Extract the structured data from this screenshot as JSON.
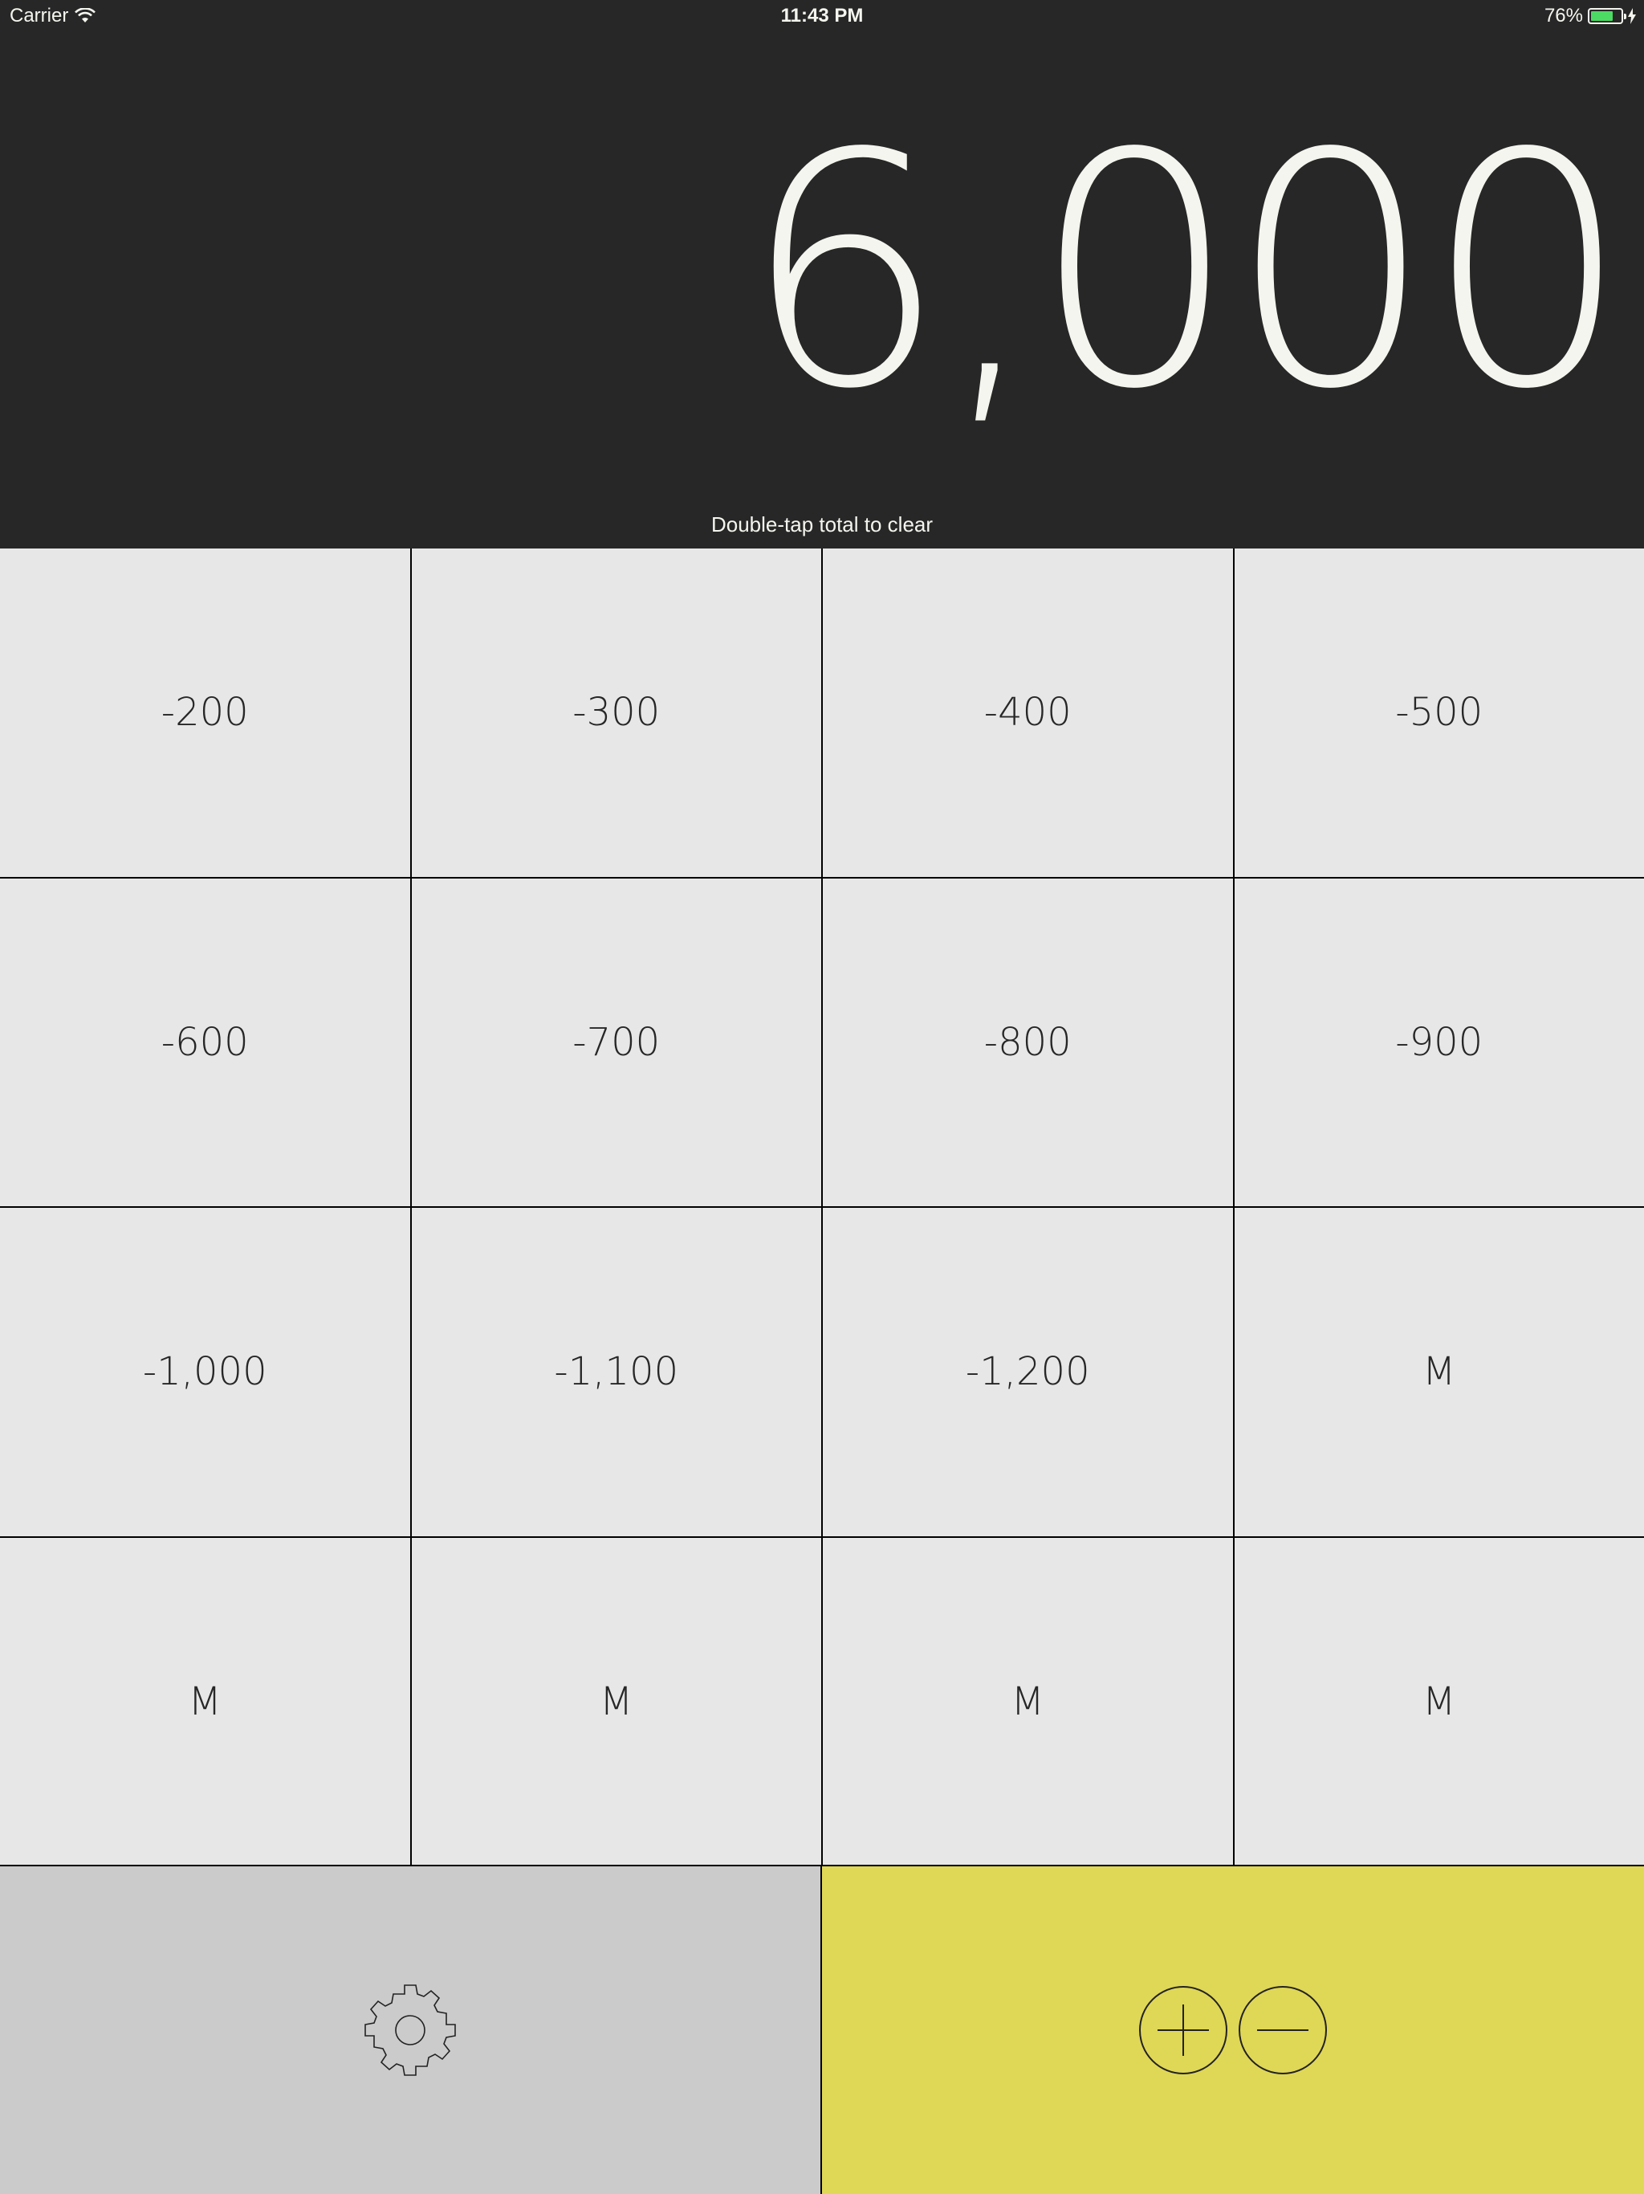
{
  "status": {
    "carrier": "Carrier",
    "time": "11:43 PM",
    "battery": "76%",
    "battery_level": 0.76
  },
  "display": {
    "total": "6,000",
    "hint": "Double-tap total to clear"
  },
  "keys": [
    "-200",
    "-300",
    "-400",
    "-500",
    "-600",
    "-700",
    "-800",
    "-900",
    "-1,000",
    "-1,100",
    "-1,200",
    "M",
    "M",
    "M",
    "M",
    "M"
  ],
  "bottom": {
    "settings_icon": "gear-icon",
    "plus_icon": "plus-circle-icon",
    "minus_icon": "minus-circle-icon",
    "settings_color": "#cbcbcb",
    "accent_color": "#dfd756"
  }
}
